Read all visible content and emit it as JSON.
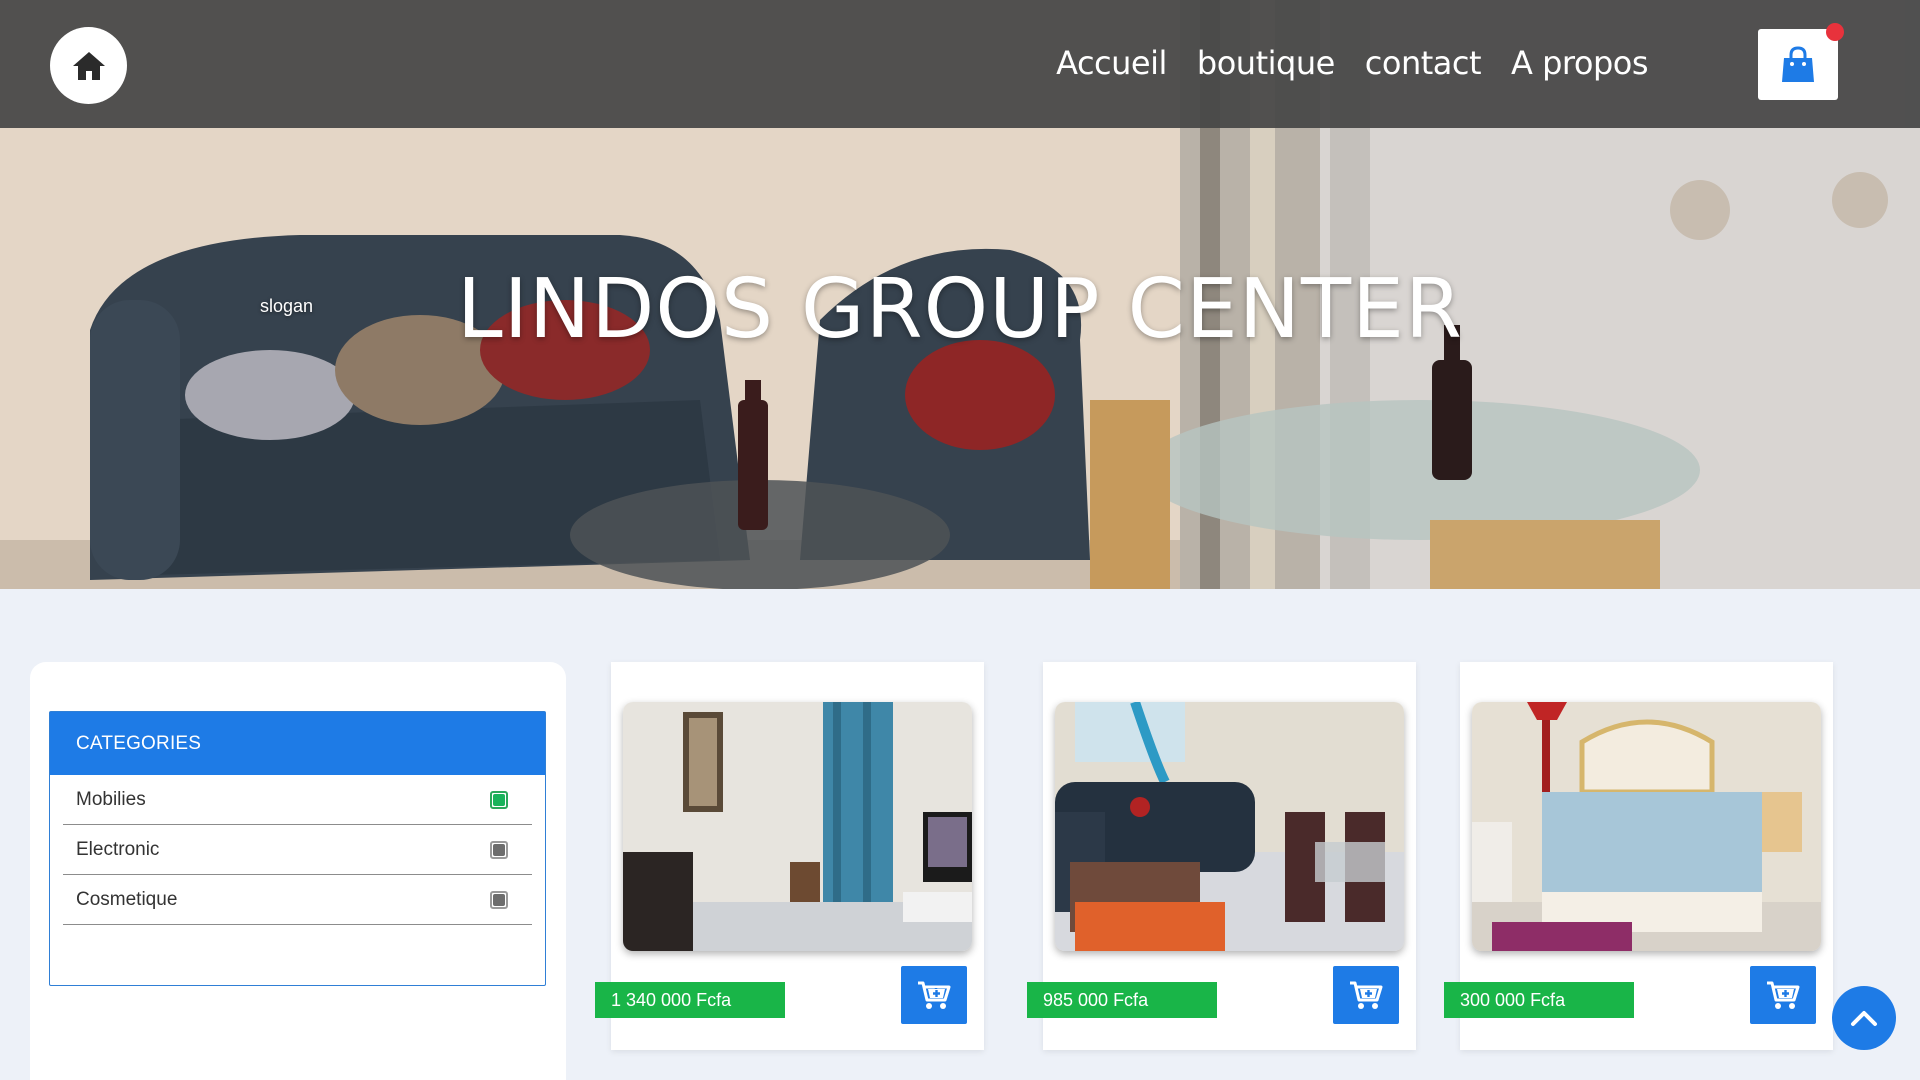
{
  "nav": {
    "links": [
      "Accueil",
      "boutique",
      "contact",
      "A propos"
    ],
    "home_icon": "home-icon",
    "cart_icon": "shopping-bag-icon"
  },
  "hero": {
    "title": "LINDOS GROUP CENTER",
    "slogan": "slogan"
  },
  "sidebar": {
    "header": "CATEGORIES",
    "items": [
      {
        "label": "Mobilies",
        "checked": true
      },
      {
        "label": "Electronic",
        "checked": false
      },
      {
        "label": "Cosmetique",
        "checked": false
      }
    ]
  },
  "products": [
    {
      "price": "1 340 000 Fcfa",
      "image": "living-room-photo"
    },
    {
      "price": "985 000 Fcfa",
      "image": "leather-sofa-photo"
    },
    {
      "price": "300 000 Fcfa",
      "image": "bedroom-photo"
    }
  ],
  "colors": {
    "primary": "#1e7be6",
    "price_green": "#19b548",
    "navbar": "#464646",
    "cart_badge": "#e8323c"
  }
}
